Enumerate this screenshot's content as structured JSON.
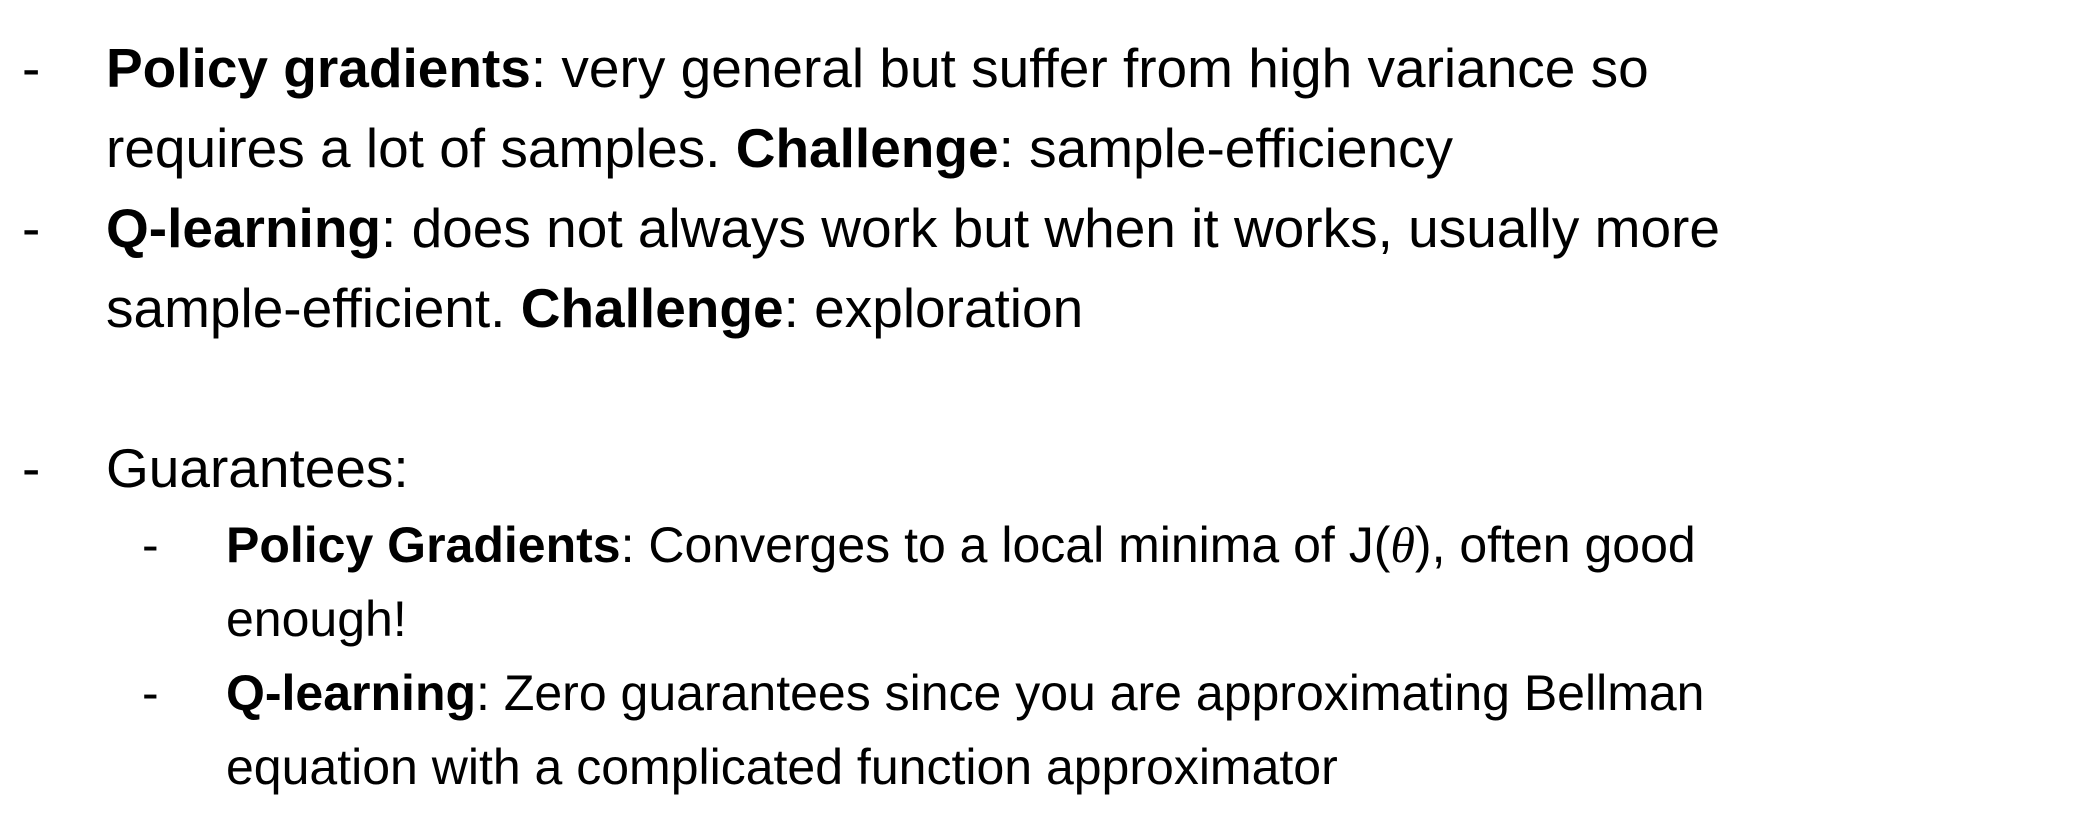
{
  "bullets": [
    {
      "dash": "-",
      "bold_term": "Policy gradients",
      "rest_line1": ": very general but suffer from high variance so",
      "line2_pre": "requires a lot of samples. ",
      "challenge_label": "Challenge",
      "challenge_text": ": sample-efficiency"
    },
    {
      "dash": "-",
      "bold_term": "Q-learning",
      "rest_line1": ": does not always work but when it works, usually more",
      "line2_pre": "sample-efficient. ",
      "challenge_label": "Challenge",
      "challenge_text": ": exploration"
    }
  ],
  "guarantees": {
    "dash": "-",
    "label": "Guarantees:",
    "sub": [
      {
        "dash": "-",
        "bold_term": "Policy Gradients",
        "line1_pre": ": Converges to a local minima of J(",
        "theta": "θ",
        "line1_post": "), often good",
        "line2": "enough!"
      },
      {
        "dash": "-",
        "bold_term": "Q-learning",
        "line1": ": Zero guarantees since you are approximating Bellman",
        "line2": "equation with a complicated function approximator"
      }
    ]
  }
}
